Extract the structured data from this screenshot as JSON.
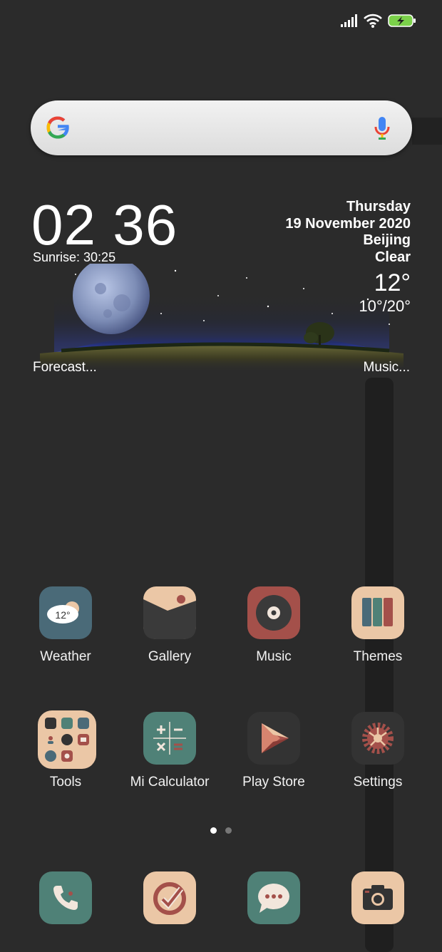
{
  "status_bar": {
    "signal_icon": "signal-bars-icon",
    "wifi_icon": "wifi-icon",
    "battery_icon": "battery-charging-icon"
  },
  "search": {
    "placeholder": "",
    "logo_icon": "google-g-icon",
    "mic_icon": "microphone-icon"
  },
  "widget": {
    "time": "02 36",
    "sunrise": "Sunrise: 30:25",
    "day": "Thursday",
    "date": "19 November 2020",
    "city": "Beijing",
    "condition": "Clear",
    "temperature": "12°",
    "range": "10°/20°",
    "forecast_link": "Forecast...",
    "music_link": "Music..."
  },
  "apps": [
    {
      "label": "Weather",
      "icon": "weather-icon",
      "badge": "12°"
    },
    {
      "label": "Gallery",
      "icon": "gallery-icon"
    },
    {
      "label": "Music",
      "icon": "music-icon"
    },
    {
      "label": "Themes",
      "icon": "themes-icon"
    },
    {
      "label": "Tools",
      "icon": "tools-folder-icon"
    },
    {
      "label": "Mi Calculator",
      "icon": "calculator-icon"
    },
    {
      "label": "Play Store",
      "icon": "play-store-icon"
    },
    {
      "label": "Settings",
      "icon": "settings-gear-icon"
    }
  ],
  "pager": {
    "pages": 2,
    "current": 1
  },
  "dock": [
    {
      "icon": "phone-icon"
    },
    {
      "icon": "security-icon"
    },
    {
      "icon": "messages-icon"
    },
    {
      "icon": "camera-icon"
    }
  ],
  "colors": {
    "background": "#2b2b2b",
    "teal": "#4f8177",
    "slate": "#4a6a78",
    "beige": "#ebc7a6",
    "red": "#a4504a",
    "dark_tile": "#333333"
  }
}
